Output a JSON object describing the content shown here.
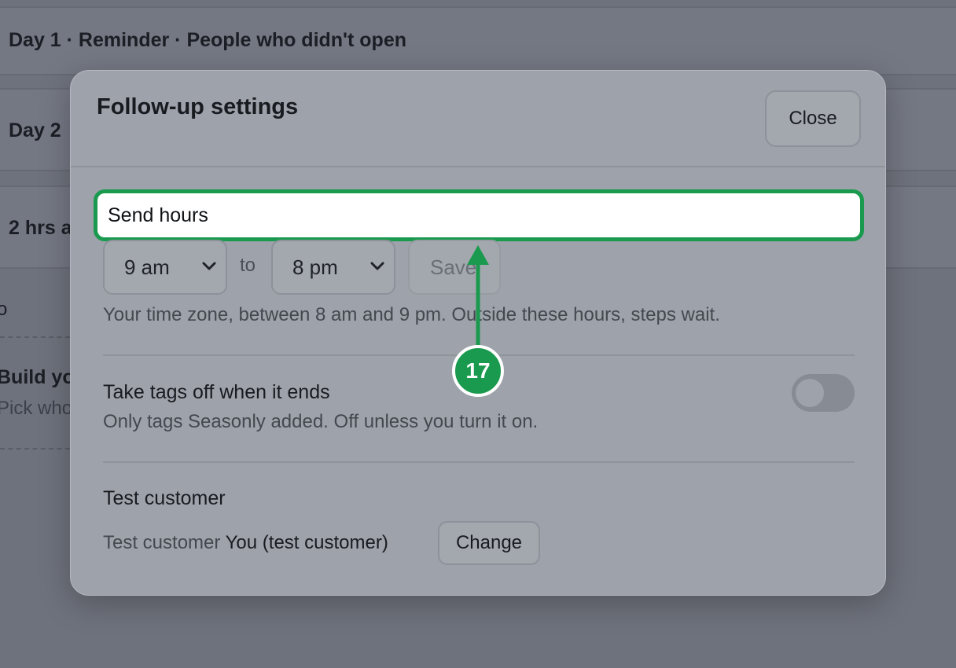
{
  "background": {
    "rows": [
      {
        "label": "Day 1 · Reminder · People who didn't open"
      },
      {
        "label": "Day 2"
      },
      {
        "label": "2 hrs a"
      }
    ],
    "side": {
      "symbol": "o",
      "title": "Build yo",
      "subtitle": "Pick who"
    }
  },
  "modal": {
    "title": "Follow-up settings",
    "close_label": "Close",
    "send_hours": {
      "label": "Send hours",
      "from_value": "9 am",
      "to_label": "to",
      "to_value": "8 pm",
      "save_label": "Save",
      "help": "Your time zone, between 8 am and 9 pm. Outside these hours, steps wait."
    },
    "tags": {
      "title": "Take tags off when it ends",
      "subtitle": "Only tags Seasonly added. Off unless you turn it on.",
      "toggle_on": false
    },
    "test_customer": {
      "title": "Test customer",
      "label": "Test customer",
      "value": "You (test customer)",
      "change_label": "Change"
    }
  },
  "annotation": {
    "step_number": "17",
    "color": "#1a9a4e"
  }
}
